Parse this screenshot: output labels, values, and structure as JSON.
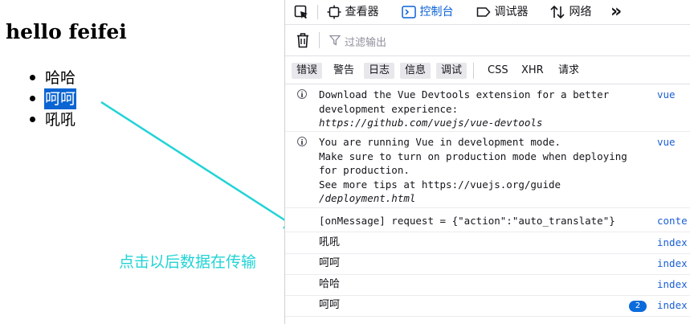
{
  "page": {
    "title": "hello feifei",
    "items": [
      "哈哈",
      "呵呵",
      "吼吼"
    ],
    "selected_item_index": 1,
    "annotation": "点击以后数据在传输",
    "annotation_color": "#22d3d6"
  },
  "devtools": {
    "tabs": [
      {
        "label": "查看器",
        "icon": "inspector-icon"
      },
      {
        "label": "控制台",
        "icon": "console-icon",
        "active": true
      },
      {
        "label": "调试器",
        "icon": "debugger-icon"
      },
      {
        "label": "网络",
        "icon": "network-icon"
      }
    ],
    "more_tabs_glyph": "»",
    "filter_placeholder": "过滤输出",
    "levels": [
      "错误",
      "警告",
      "日志",
      "信息",
      "调试"
    ],
    "types": [
      "CSS",
      "XHR",
      "请求"
    ],
    "accent_color": "#0a60d8",
    "messages": [
      {
        "lines": [
          "Download the Vue Devtools extension for a better",
          "development experience:",
          "https://github.com/vuejs/vue-devtools"
        ],
        "source": "vue",
        "icon": "info-icon"
      },
      {
        "lines": [
          "You are running Vue in development mode.",
          "Make sure to turn on production mode when deploying",
          "for production.",
          "See more tips at https://vuejs.org/guide",
          "/deployment.html"
        ],
        "source": "vue",
        "icon": "info-icon"
      },
      {
        "text": "[onMessage] request = {\"action\":\"auto_translate\"}",
        "source": "conte"
      },
      {
        "text": "吼吼",
        "source": "index"
      },
      {
        "text": "呵呵",
        "source": "index"
      },
      {
        "text": "哈哈",
        "source": "index"
      },
      {
        "text": "呵呵",
        "source": "index",
        "repeat": "2"
      }
    ]
  }
}
